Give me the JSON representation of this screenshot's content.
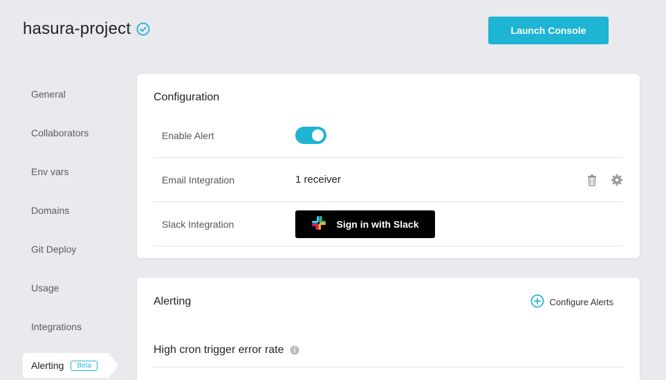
{
  "project": {
    "name": "hasura-project",
    "verified_icon": "check-circle-icon",
    "launch_label": "Launch Console"
  },
  "sidebar": {
    "items": [
      {
        "label": "General"
      },
      {
        "label": "Collaborators"
      },
      {
        "label": "Env vars"
      },
      {
        "label": "Domains"
      },
      {
        "label": "Git Deploy"
      },
      {
        "label": "Usage"
      },
      {
        "label": "Integrations"
      },
      {
        "label": "Alerting",
        "badge": "Beta",
        "active": true
      }
    ]
  },
  "configuration": {
    "title": "Configuration",
    "enable_alert": {
      "label": "Enable Alert",
      "on": true
    },
    "email": {
      "label": "Email Integration",
      "value": "1 receiver"
    },
    "slack": {
      "label": "Slack Integration",
      "button": "Sign in with Slack"
    }
  },
  "alerting": {
    "title": "Alerting",
    "configure_label": "Configure Alerts",
    "items": [
      {
        "label": "High cron trigger error rate"
      }
    ]
  },
  "colors": {
    "accent": "#1eb4d4",
    "background": "#e8eaee",
    "slack_button": "#000000"
  }
}
